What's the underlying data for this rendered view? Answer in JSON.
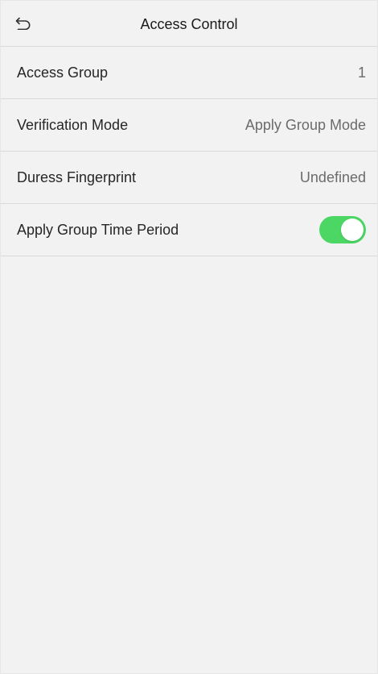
{
  "header": {
    "title": "Access Control",
    "back_icon": "back-arrow-icon"
  },
  "settings": [
    {
      "label": "Access Group",
      "value": "1"
    },
    {
      "label": "Verification Mode",
      "value": "Apply Group Mode"
    },
    {
      "label": "Duress Fingerprint",
      "value": "Undefined"
    },
    {
      "label": "Apply Group Time Period",
      "toggle_on": true
    }
  ],
  "colors": {
    "background": "#f2f2f2",
    "divider": "#d9d9d9",
    "toggle_on": "#4cd764"
  }
}
